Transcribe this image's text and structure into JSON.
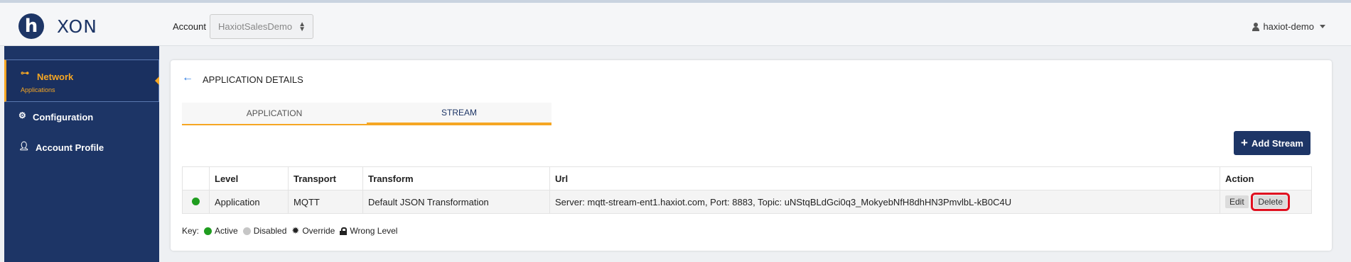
{
  "header": {
    "logo_text": "XON",
    "logo_mark": "h",
    "account_label": "Account",
    "account_value": "HaxiotSalesDemo",
    "user_name": "haxiot-demo"
  },
  "sidebar": {
    "items": [
      {
        "label": "Network",
        "sub": "Applications",
        "icon": "network-icon"
      },
      {
        "label": "Configuration",
        "icon": "gear-icon"
      },
      {
        "label": "Account Profile",
        "icon": "user-icon"
      }
    ]
  },
  "page": {
    "title": "APPLICATION DETAILS",
    "tabs": [
      {
        "label": "APPLICATION"
      },
      {
        "label": "STREAM"
      }
    ],
    "add_stream_label": "Add Stream"
  },
  "table": {
    "headers": [
      "",
      "Level",
      "Transport",
      "Transform",
      "Url",
      "Action"
    ],
    "rows": [
      {
        "status_color": "#1f9d1f",
        "level": "Application",
        "transport": "MQTT",
        "transform": "Default JSON Transformation",
        "url": "Server: mqtt-stream-ent1.haxiot.com, Port: 8883, Topic: uNStqBLdGci0q3_MokyebNfH8dhHN3PmvlbL-kB0C4U",
        "edit_label": "Edit",
        "delete_label": "Delete"
      }
    ]
  },
  "key": {
    "label": "Key:",
    "items": [
      "Active",
      "Disabled",
      "Override",
      "Wrong Level"
    ]
  },
  "colors": {
    "brand": "#1d3566",
    "accent": "#f5a623",
    "active": "#1f9d1f",
    "highlight": "#e01020"
  }
}
